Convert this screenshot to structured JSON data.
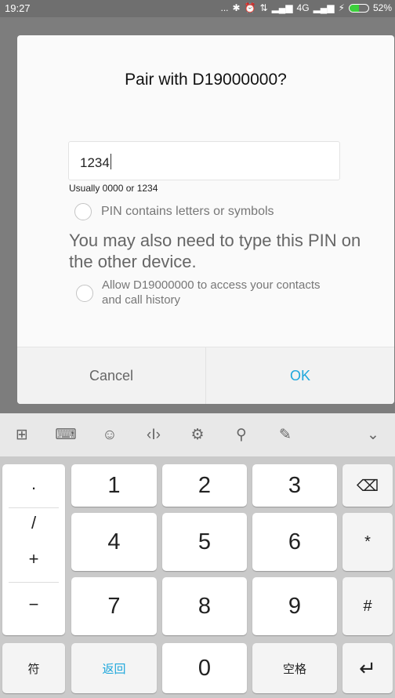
{
  "status_bar": {
    "time": "19:27",
    "indicators": "...",
    "network_1": "4G",
    "battery_percent": "52%",
    "battery_level": 0.52
  },
  "dialog": {
    "title": "Pair with D19000000?",
    "pin_value": "1234",
    "pin_hint": "Usually 0000 or 1234",
    "pin_letters_option": "PIN contains letters or symbols",
    "note": "You may also need to type this PIN on the other device.",
    "allow_access_option": "Allow D19000000 to access your contacts and call history",
    "cancel_label": "Cancel",
    "ok_label": "OK"
  },
  "keyboard": {
    "digits": [
      "1",
      "2",
      "3",
      "4",
      "5",
      "6",
      "7",
      "8",
      "9",
      "0"
    ],
    "side_symbols": [
      ".",
      "/",
      "+",
      "−"
    ],
    "star": "*",
    "hash": "#",
    "symbols_key": "符",
    "back_key": "返回",
    "space_key": "空格",
    "colors": {
      "accent": "#1ea7dc"
    }
  }
}
